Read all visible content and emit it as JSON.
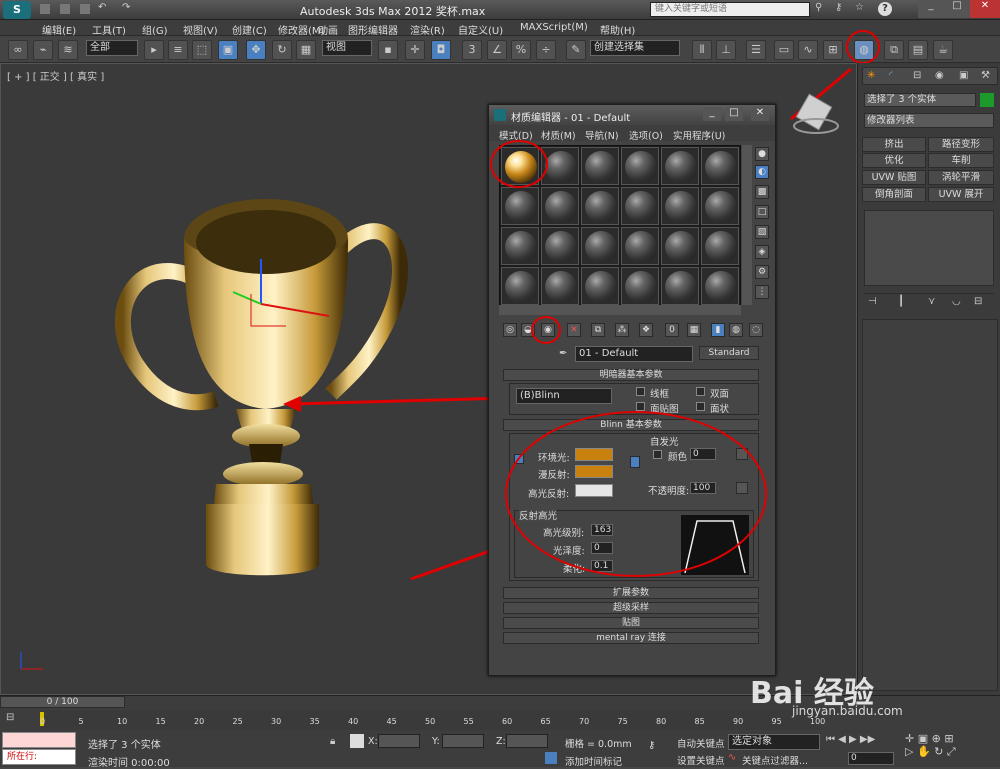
{
  "window": {
    "title": "Autodesk 3ds Max  2012   奖杯.max",
    "search_placeholder": "键入关键字或短语"
  },
  "menubar": [
    "编辑(E)",
    "工具(T)",
    "组(G)",
    "视图(V)",
    "创建(C)",
    "修改器(M)",
    "动画",
    "图形编辑器",
    "渲染(R)",
    "自定义(U)",
    "MAXScript(M)",
    "帮助(H)"
  ],
  "toolbar": {
    "filter": "全部",
    "view": "视图",
    "selection_set": "创建选择集",
    "snap_label": "3",
    "percent_label": "%"
  },
  "viewport": {
    "label": "[ + ] [ 正交 ] [ 真实 ]"
  },
  "command_panel": {
    "selection_info": "选择了 3 个实体",
    "modifier_list": "修改器列表",
    "buttons": [
      "挤出",
      "路径变形",
      "优化",
      "车削",
      "UVW 贴图",
      "涡轮平滑",
      "倒角剖面",
      "UVW 展开"
    ]
  },
  "material_editor": {
    "title": "材质编辑器 - 01 - Default",
    "menu": [
      "模式(D)",
      "材质(M)",
      "导航(N)",
      "选项(O)",
      "实用程序(U)"
    ],
    "material_name": "01 - Default",
    "material_type": "Standard",
    "shader_rollout": "明暗器基本参数",
    "shader": "(B)Blinn",
    "wire": "线框",
    "two_sided": "双面",
    "face_map": "面贴图",
    "faceted": "面状",
    "blinn_rollout": "Blinn 基本参数",
    "self_illum": "自发光",
    "color": "颜色",
    "self_illum_value": "0",
    "ambient": "环境光:",
    "diffuse": "漫反射:",
    "specular": "高光反射:",
    "opacity_label": "不透明度:",
    "opacity_value": "100",
    "spec_group": "反射高光",
    "spec_level_label": "高光级别:",
    "spec_level": "163",
    "glossiness_label": "光泽度:",
    "glossiness": "0",
    "soften_label": "柔化:",
    "soften": "0.1",
    "rollouts": [
      "扩展参数",
      "超级采样",
      "贴图",
      "mental ray 连接"
    ],
    "colors": {
      "ambient": "#c8800f",
      "diffuse": "#c8800f",
      "specular": "#e6e6e6"
    }
  },
  "timeline": {
    "frame": "0 / 100",
    "ticks": [
      "0",
      "5",
      "10",
      "15",
      "20",
      "25",
      "30",
      "35",
      "40",
      "45",
      "50",
      "55",
      "60",
      "65",
      "70",
      "75",
      "80",
      "85",
      "90",
      "95",
      "100"
    ]
  },
  "status": {
    "selection": "选择了 3 个实体",
    "render_time": "渲染时间 0:00:00",
    "x_label": "X:",
    "y_label": "Y:",
    "z_label": "Z:",
    "grid": "栅格 = 0.0mm",
    "add_key": "添加时间标记",
    "auto_key": "自动关键点",
    "set_key": "设置关键点",
    "selected": "选定对象",
    "key_filters": "关键点过滤器...",
    "current": "所在行:",
    "frame_value": "0"
  },
  "watermark": "jingyan.baidu.com"
}
